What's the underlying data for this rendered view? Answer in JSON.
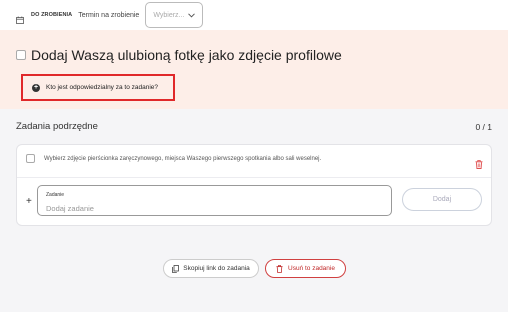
{
  "top_bar": {
    "status_label": "DO ZROBIENIA",
    "deadline_label": "Termin na zrobienie",
    "deadline_select": {
      "value": "Wybierz..."
    }
  },
  "task": {
    "title": "Dodaj Waszą ulubioną fotkę jako zdjęcie profilowe",
    "assign_label": "Kto jest odpowiedzialny za to zadanie?"
  },
  "subtasks": {
    "header": "Zadania podrzędne",
    "count": "0 / 1",
    "items": [
      {
        "text": "Wybierz zdjęcie pierścionka zaręczynowego, miejsca Waszego pierwszego spotkania albo sali weselnej."
      }
    ],
    "new_field": {
      "label": "Zadanie",
      "placeholder": "Dodaj zadanie"
    },
    "add_button": "Dodaj"
  },
  "actions": {
    "copy_link": "Skopiuj link do zadania",
    "delete": "Usuń to zadanie"
  },
  "colors": {
    "accent_red": "#e0282a",
    "band_bg": "#fdeee8",
    "page_bg": "#f5f5f7"
  }
}
